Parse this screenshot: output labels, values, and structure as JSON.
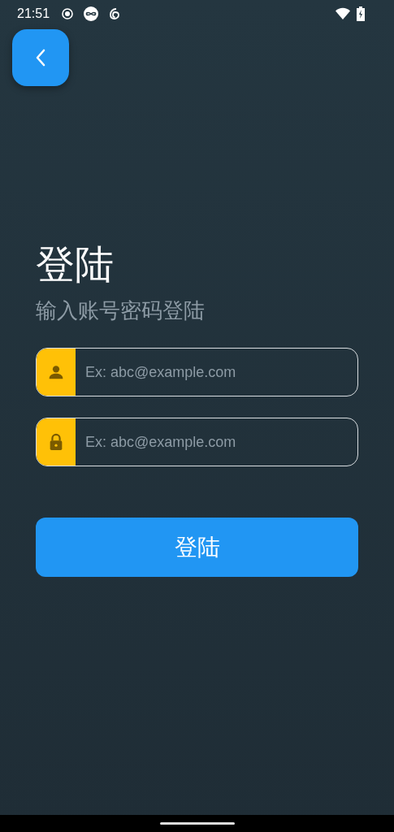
{
  "status_bar": {
    "time": "21:51"
  },
  "title": "登陆",
  "subtitle": "输入账号密码登陆",
  "fields": [
    {
      "kind": "user",
      "placeholder": "Ex: abc@example.com"
    },
    {
      "kind": "lock",
      "placeholder": "Ex: abc@example.com"
    }
  ],
  "submit_button": "登陆"
}
